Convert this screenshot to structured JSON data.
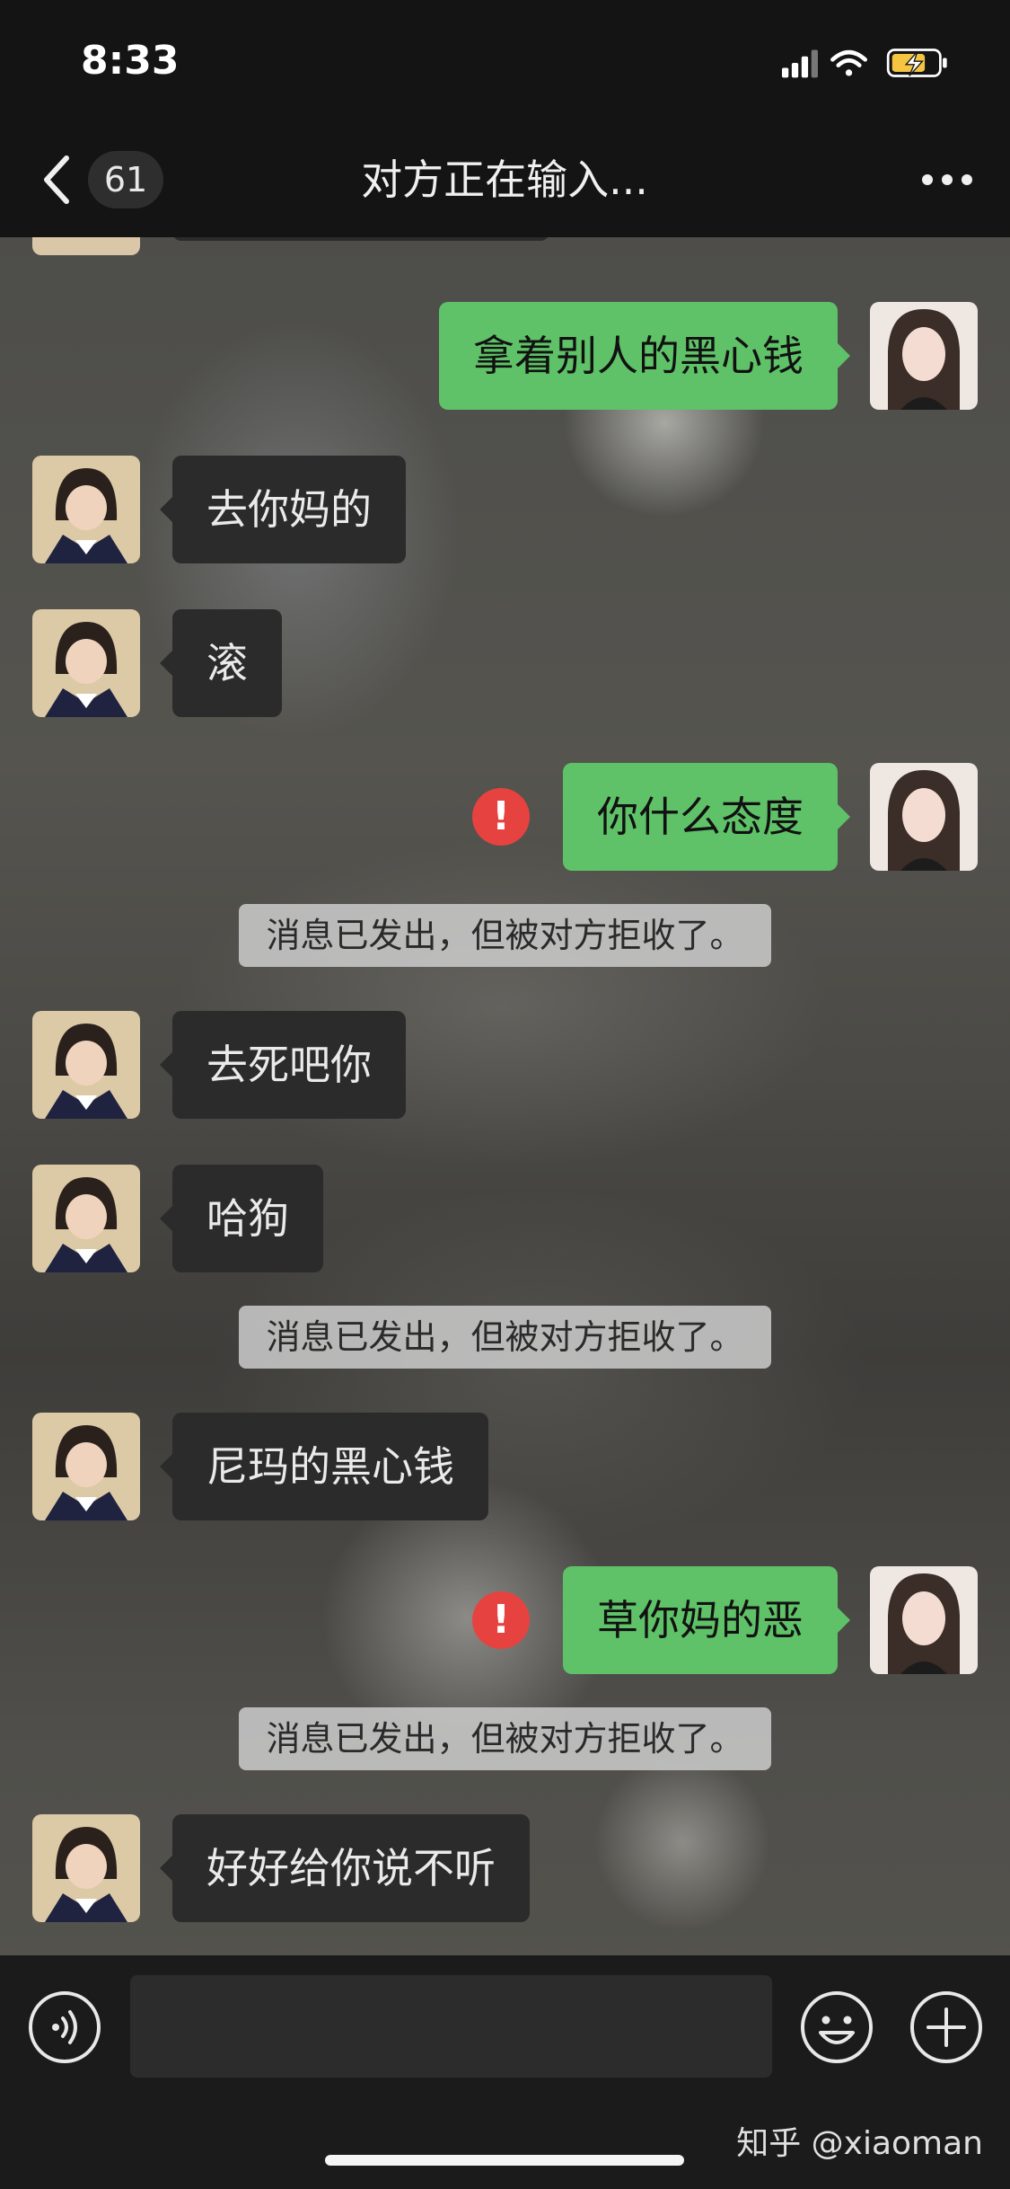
{
  "status_bar": {
    "time": "8:33"
  },
  "nav": {
    "back_count": "61",
    "title": "对方正在输入..."
  },
  "messages": [
    {
      "side": "out",
      "text": "拿着别人的黑心钱"
    },
    {
      "side": "in",
      "text": "去你妈的"
    },
    {
      "side": "in",
      "text": "滚"
    },
    {
      "side": "out",
      "text": "你什么态度",
      "failed": true
    },
    {
      "side": "in",
      "text": "去死吧你"
    },
    {
      "side": "in",
      "text": "哈狗"
    },
    {
      "side": "in",
      "text": "尼玛的黑心钱"
    },
    {
      "side": "out",
      "text": "草你妈的恶",
      "failed": true
    },
    {
      "side": "in",
      "text": "好好给你说不听"
    }
  ],
  "system_notices": [
    "消息已发出，但被对方拒收了。",
    "消息已发出，但被对方拒收了。",
    "消息已发出，但被对方拒收了。"
  ],
  "error_icon_glyph": "!",
  "watermark": "知乎 @xiaoman",
  "colors": {
    "outgoing_bubble": "#5fc268",
    "incoming_bubble": "#2b2b2b",
    "error": "#e64340",
    "bars": "#141414"
  },
  "icons": {
    "back": "chevron-left-icon",
    "more": "ellipsis-icon",
    "voice": "voice-icon",
    "emoji": "smiley-icon",
    "plus": "plus-circle-icon",
    "error": "exclamation-icon"
  }
}
